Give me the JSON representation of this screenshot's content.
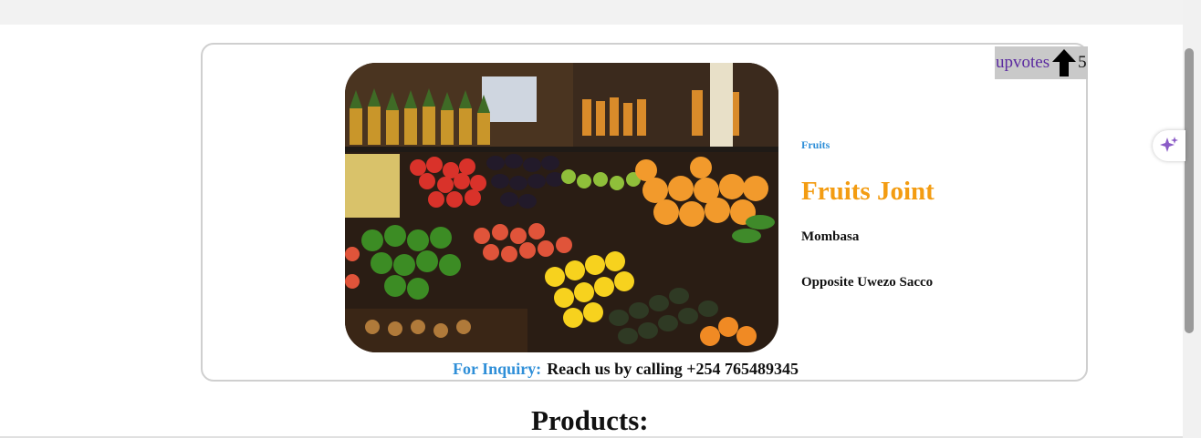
{
  "listing": {
    "upvote_label": "upvotes",
    "upvote_count": "5",
    "category": "Fruits",
    "name": "Fruits Joint",
    "city": "Mombasa",
    "landmark": "Opposite Uwezo Sacco",
    "inquiry_label": "For Inquiry:",
    "inquiry_text": "Reach us by calling +254 765489345"
  },
  "products_heading": "Products:",
  "icons": {
    "upvote": "arrow-up-icon",
    "assistant": "sparkle-icon"
  },
  "colors": {
    "category": "#2f8fd8",
    "name": "#f39c12",
    "inquiry_label": "#2f8fd8",
    "upvote_label": "#5b2aa0",
    "upvote_bg": "#c9c9c9"
  }
}
